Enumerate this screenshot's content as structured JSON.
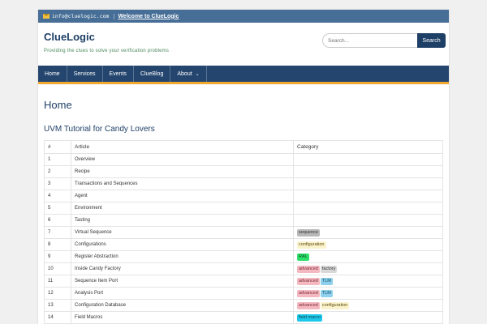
{
  "topbar": {
    "email": "info@cluelogic.com",
    "welcome": "Welcome to ClueLogic"
  },
  "header": {
    "site_title": "ClueLogic",
    "tagline": "Providing the clues to solve your verification problems",
    "search_placeholder": "Search...",
    "search_button": "Search"
  },
  "nav": [
    {
      "label": "Home"
    },
    {
      "label": "Services"
    },
    {
      "label": "Events"
    },
    {
      "label": "ClueBlog"
    },
    {
      "label": "About"
    }
  ],
  "main": {
    "page_title": "Home",
    "section_title": "UVM Tutorial for Candy Lovers",
    "table": {
      "headers": [
        "#",
        "Article",
        "Category"
      ],
      "rows": [
        {
          "num": "1",
          "article": "Overview",
          "tags": []
        },
        {
          "num": "2",
          "article": "Recipe",
          "tags": []
        },
        {
          "num": "3",
          "article": "Transactions and Sequences",
          "tags": []
        },
        {
          "num": "4",
          "article": "Agent",
          "tags": []
        },
        {
          "num": "5",
          "article": "Environment",
          "tags": []
        },
        {
          "num": "6",
          "article": "Tasting",
          "tags": []
        },
        {
          "num": "7",
          "article": "Virtual Sequence",
          "tags": [
            {
              "label": "sequence",
              "bg": "#b8b8b8",
              "fg": "#333333"
            }
          ]
        },
        {
          "num": "8",
          "article": "Configurations",
          "tags": [
            {
              "label": "configuration",
              "bg": "#fbf3cc",
              "fg": "#5a4a10"
            }
          ]
        },
        {
          "num": "9",
          "article": "Register Abstraction",
          "tags": [
            {
              "label": "RAL",
              "bg": "#2ee06a",
              "fg": "#0a4a1e"
            }
          ]
        },
        {
          "num": "10",
          "article": "Inside Candy Factory",
          "tags": [
            {
              "label": "advanced",
              "bg": "#f4b8c0",
              "fg": "#7a2a34"
            },
            {
              "label": "factory",
              "bg": "#d8d8d8",
              "fg": "#333333"
            }
          ]
        },
        {
          "num": "11",
          "article": "Sequence Item Port",
          "tags": [
            {
              "label": "advanced",
              "bg": "#f4b8c0",
              "fg": "#7a2a34"
            },
            {
              "label": "TLM",
              "bg": "#8fd0ec",
              "fg": "#0e4a66"
            }
          ]
        },
        {
          "num": "12",
          "article": "Analysis Port",
          "tags": [
            {
              "label": "advanced",
              "bg": "#f4b8c0",
              "fg": "#7a2a34"
            },
            {
              "label": "TLM",
              "bg": "#8fd0ec",
              "fg": "#0e4a66"
            }
          ]
        },
        {
          "num": "13",
          "article": "Configuration Database",
          "tags": [
            {
              "label": "advanced",
              "bg": "#f4b8c0",
              "fg": "#7a2a34"
            },
            {
              "label": "configuration",
              "bg": "#fbf3cc",
              "fg": "#5a4a10"
            }
          ]
        },
        {
          "num": "14",
          "article": "Field Macros",
          "tags": [
            {
              "label": "field macro",
              "bg": "#1ec8e8",
              "fg": "#0a4a5a"
            }
          ]
        }
      ]
    }
  },
  "colors": {
    "topbar": "#466e96",
    "nav": "#24466e",
    "nav_accent": "#f0a830",
    "title": "#1e3f66"
  }
}
